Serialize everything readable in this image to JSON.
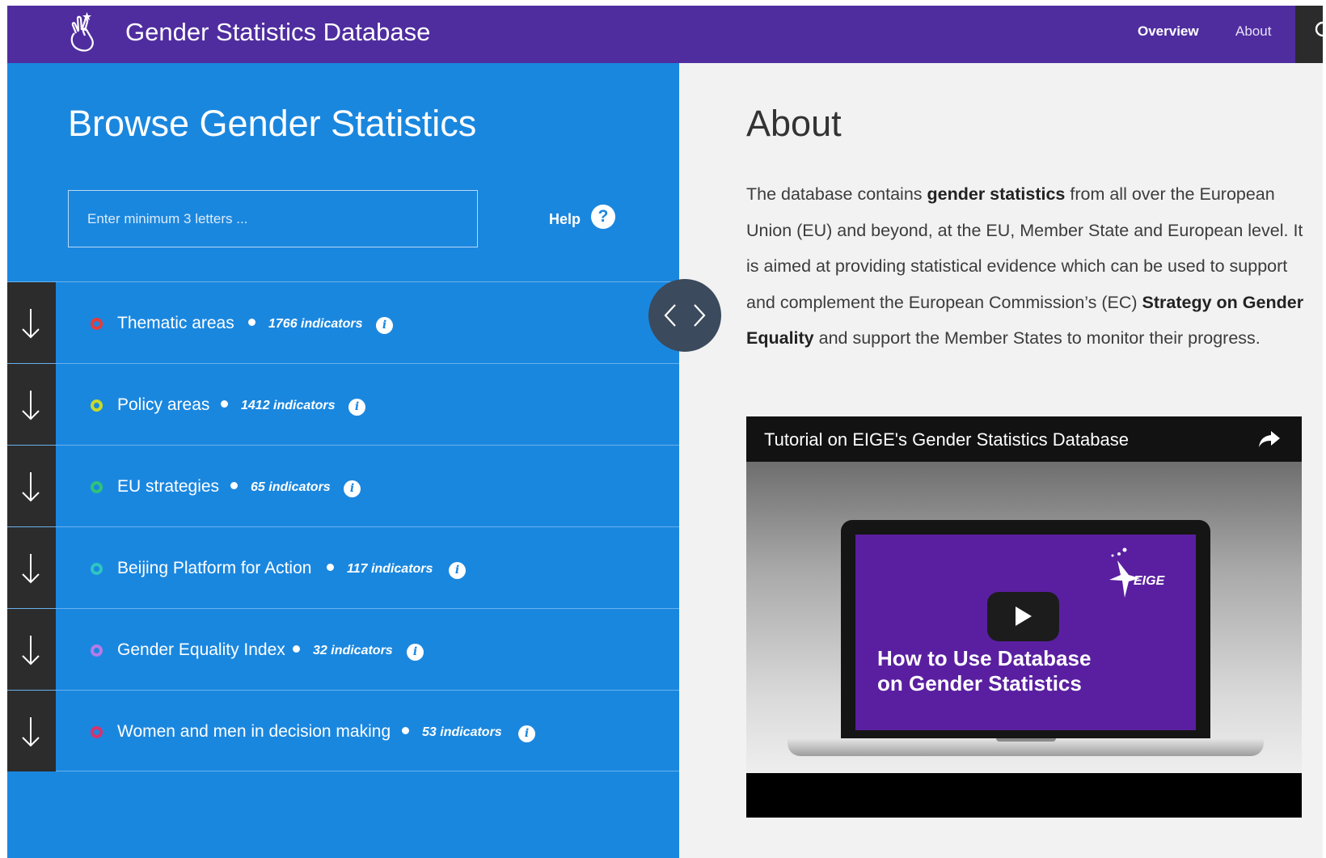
{
  "header": {
    "app_title": "Gender Statistics Database",
    "nav": [
      {
        "label": "Overview"
      },
      {
        "label": "About"
      }
    ]
  },
  "browse": {
    "title": "Browse Gender Statistics",
    "search_placeholder": "Enter minimum 3 letters ...",
    "help_label": "Help",
    "categories": [
      {
        "label": "Thematic areas",
        "count": "1766 indicators",
        "color": "#e63b3b"
      },
      {
        "label": "Policy areas",
        "count": "1412 indicators",
        "color": "#c8d92d"
      },
      {
        "label": "EU strategies",
        "count": "65 indicators",
        "color": "#2fc27a"
      },
      {
        "label": "Beijing Platform for Action",
        "count": "117 indicators",
        "color": "#2ec4c4"
      },
      {
        "label": "Gender Equality Index",
        "count": "32 indicators",
        "color": "#b57be8"
      },
      {
        "label": "Women and men in decision making",
        "count": "53 indicators",
        "color": "#d6336c"
      }
    ]
  },
  "about": {
    "title": "About",
    "text_1": "The database contains ",
    "bold_1": "gender statistics",
    "text_2": " from all over the European Union (EU) and beyond, at the EU, Member State and European level. It is aimed at providing statistical evidence which can be used to support and complement the European Commission’s (EC) ",
    "bold_2": "Strategy on Gender Equality",
    "text_3": " and support the Member States to monitor their progress."
  },
  "video": {
    "title": "Tutorial on EIGE's Gender Statistics Database",
    "thumb_line_1": "How to Use Database",
    "thumb_line_2": "on Gender Statistics",
    "logo_text": "EIGE"
  }
}
